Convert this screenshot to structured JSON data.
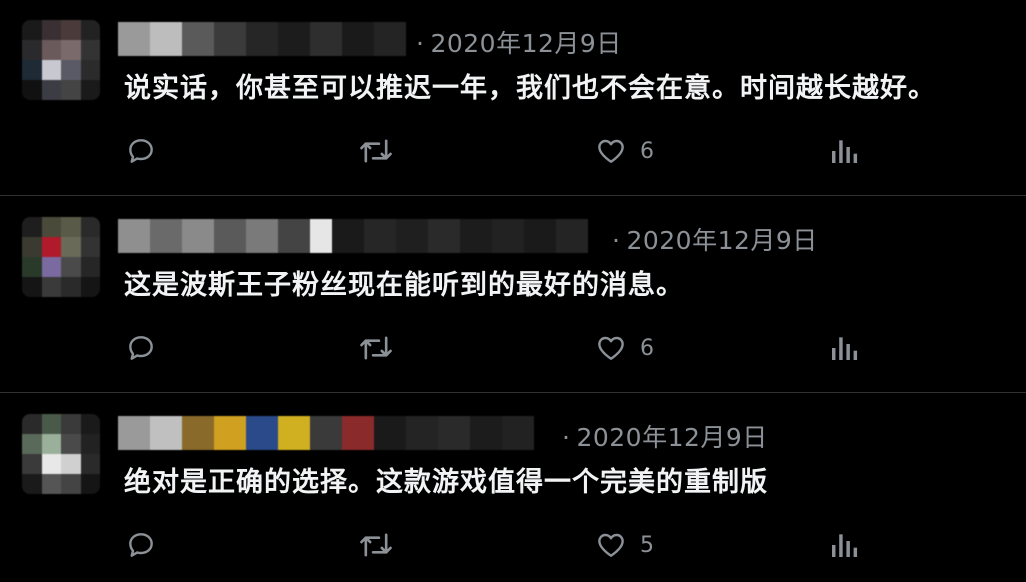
{
  "colors": {
    "background": "#000000",
    "text": "#f2f3f4",
    "muted": "#8b9196",
    "divider": "#2f3336"
  },
  "icons": {
    "reply": "reply-icon",
    "retweet": "retweet-icon",
    "like": "heart-icon",
    "views": "views-icon"
  },
  "tweets": [
    {
      "date": "2020年12月9日",
      "text": "说实话，你甚至可以推迟一年，我们也不会在意。时间越长越好。",
      "likes": "6"
    },
    {
      "date": "2020年12月9日",
      "text": "这是波斯王子粉丝现在能听到的最好的消息。",
      "likes": "6"
    },
    {
      "date": "2020年12月9日",
      "text": "绝对是正确的选择。这款游戏值得一个完美的重制版",
      "likes": "5"
    }
  ]
}
